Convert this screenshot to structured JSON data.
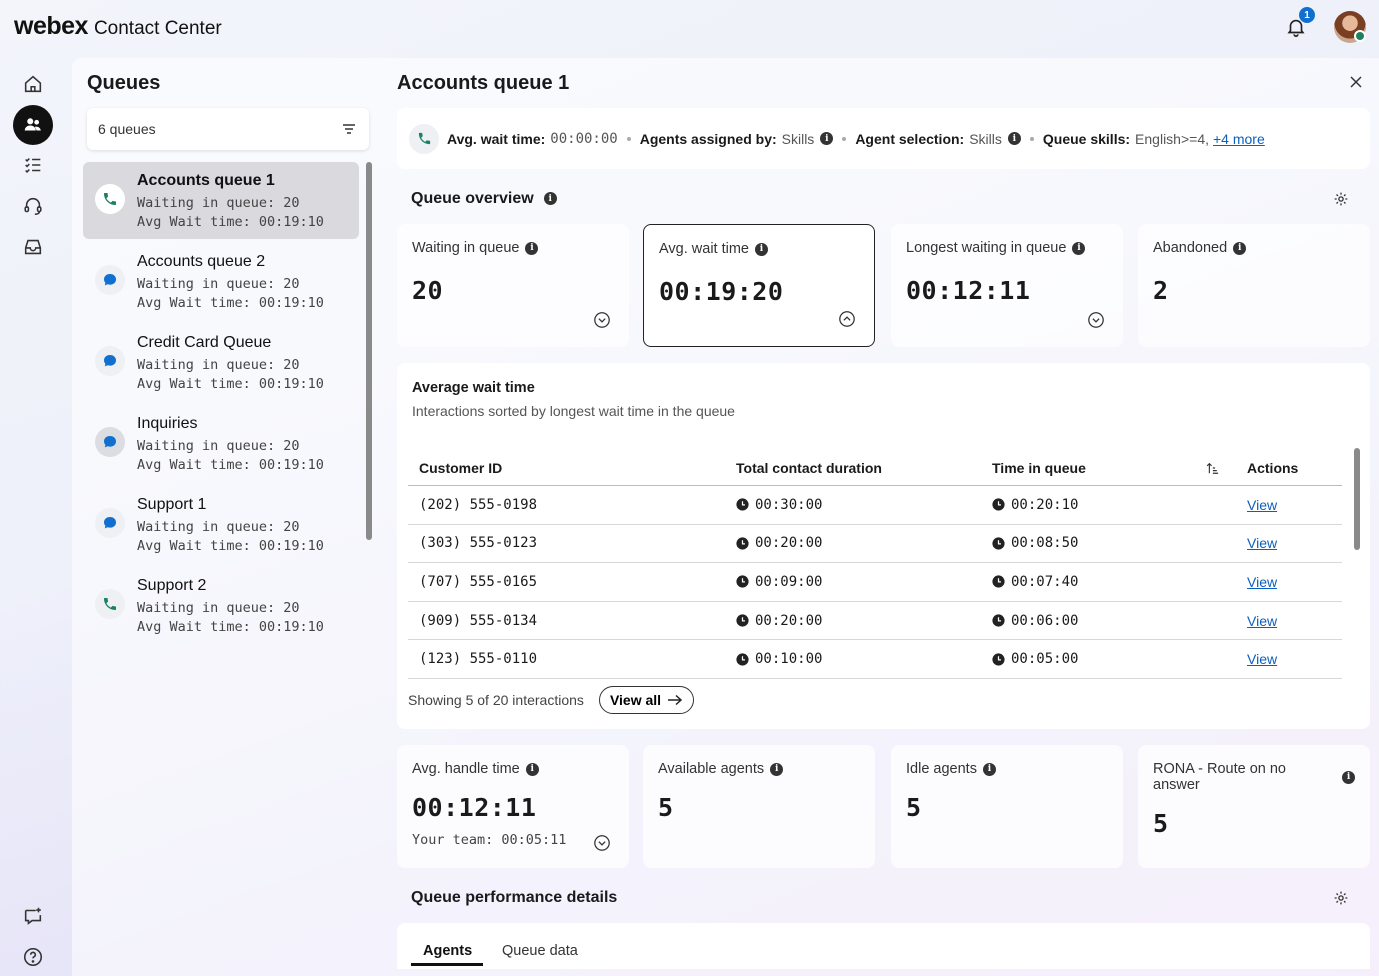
{
  "app": {
    "logo": "webex",
    "product": "Contact Center",
    "notification_count": "1"
  },
  "rail": {
    "items": [
      "home-icon",
      "queues-icon",
      "tasks-icon",
      "headset-icon",
      "inbox-icon"
    ],
    "bottom": [
      "feedback-icon",
      "help-icon"
    ]
  },
  "queues": {
    "title": "Queues",
    "count_label": "6 queues",
    "items": [
      {
        "name": "Accounts queue 1",
        "waiting": "Waiting in queue: 20",
        "avg": "Avg Wait time: 00:19:10",
        "channel": "phone"
      },
      {
        "name": "Accounts queue 2",
        "waiting": "Waiting in queue: 20",
        "avg": "Avg Wait time: 00:19:10",
        "channel": "chat"
      },
      {
        "name": "Credit Card Queue",
        "waiting": "Waiting in queue: 20",
        "avg": "Avg Wait time: 00:19:10",
        "channel": "chat"
      },
      {
        "name": "Inquiries",
        "waiting": "Waiting in queue: 20",
        "avg": "Avg Wait time: 00:19:10",
        "channel": "chat"
      },
      {
        "name": "Support 1",
        "waiting": "Waiting in queue: 20",
        "avg": "Avg Wait time: 00:19:10",
        "channel": "chat"
      },
      {
        "name": "Support 2",
        "waiting": "Waiting in queue: 20",
        "avg": "Avg Wait time: 00:19:10",
        "channel": "phone"
      }
    ]
  },
  "detail": {
    "title": "Accounts queue 1",
    "info": {
      "avg_wait_label": "Avg. wait time:",
      "avg_wait_value": "00:00:00",
      "assigned_label": "Agents assigned by:",
      "assigned_value": "Skills",
      "selection_label": "Agent selection:",
      "selection_value": "Skills",
      "skills_label": "Queue skills:",
      "skills_value": "English>=4,",
      "more": "+4 more"
    },
    "overview": {
      "title": "Queue overview",
      "cards": [
        {
          "label": "Waiting in queue",
          "value": "20"
        },
        {
          "label": "Avg. wait time",
          "value": "00:19:20"
        },
        {
          "label": "Longest waiting in queue",
          "value": "00:12:11"
        },
        {
          "label": "Abandoned",
          "value": "2"
        }
      ]
    },
    "avg_wait": {
      "title": "Average wait time",
      "subtitle": "Interactions sorted by longest wait time in the queue",
      "columns": [
        "Customer ID",
        "Total contact duration",
        "Time in queue",
        "Actions"
      ],
      "rows": [
        {
          "id": "(202) 555-0198",
          "duration": "00:30:00",
          "queue": "00:20:10",
          "action": "View"
        },
        {
          "id": "(303) 555-0123",
          "duration": "00:20:00",
          "queue": "00:08:50",
          "action": "View"
        },
        {
          "id": "(707) 555-0165",
          "duration": "00:09:00",
          "queue": "00:07:40",
          "action": "View"
        },
        {
          "id": "(909) 555-0134",
          "duration": "00:20:00",
          "queue": "00:06:00",
          "action": "View"
        },
        {
          "id": "(123) 555-0110",
          "duration": "00:10:00",
          "queue": "00:05:00",
          "action": "View"
        }
      ],
      "showing": "Showing 5 of 20 interactions",
      "view_all": "View all"
    },
    "agents_cards": [
      {
        "label": "Avg. handle time",
        "value": "00:12:11",
        "sub": "Your team: 00:05:11"
      },
      {
        "label": "Available agents",
        "value": "5"
      },
      {
        "label": "Idle agents",
        "value": "5"
      },
      {
        "label": "RONA - Route on no answer",
        "value": "5"
      }
    ],
    "performance": {
      "title": "Queue performance details",
      "tabs": [
        "Agents",
        "Queue data"
      ]
    }
  },
  "colors": {
    "accent": "#1170cf",
    "phone": "#1d8160",
    "chat": "#1170cf",
    "link": "#0b5fbf"
  }
}
